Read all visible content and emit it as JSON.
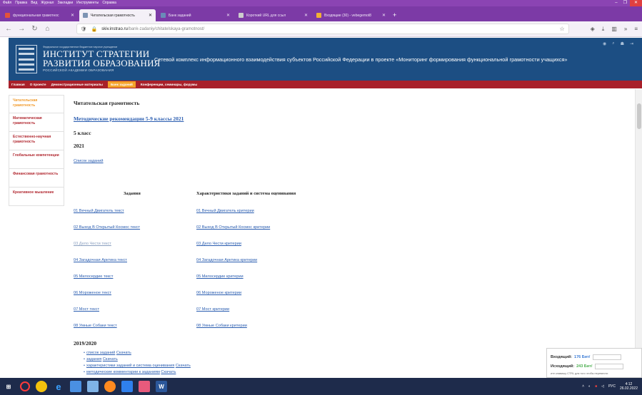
{
  "browser": {
    "menu": [
      "Файл",
      "Правка",
      "Вид",
      "Журнал",
      "Закладки",
      "Инструменты",
      "Справка"
    ],
    "window_controls": [
      "–",
      "❐",
      "✕"
    ],
    "tabs": [
      {
        "label": "функциональная грамотнос",
        "active": false,
        "color": "#e2533a"
      },
      {
        "label": "Читательская грамотность",
        "active": true,
        "color": "#7d93b3"
      },
      {
        "label": "Банк заданий",
        "active": false,
        "color": "#6a8bb8"
      },
      {
        "label": "Короткий URL для ссыл",
        "active": false,
        "color": "#cccccc"
      },
      {
        "label": "Входящие (30) - vebegemot8",
        "active": false,
        "color": "#f2b134"
      }
    ],
    "new_tab": "+",
    "url_host": "skiv.instrao.ru",
    "url_path": "/bank-zadaniy/chitatelskaya-gramotnost/"
  },
  "site": {
    "logo_small": "Федеральное государственное бюджетное научное учреждение",
    "logo_line1": "ИНСТИТУТ СТРАТЕГИИ",
    "logo_line2": "РАЗВИТИЯ ОБРАЗОВАНИЯ",
    "logo_sub": "РОССИЙСКОЙ АКАДЕМИИ ОБРАЗОВАНИЯ",
    "slogan": "Сетевой комплекс информационного взаимодействия субъектов Российской Федерации в проекте «Мониторинг формирования функциональной грамотности учащихся»",
    "nav": [
      {
        "label": "Главная",
        "active": false
      },
      {
        "label": "О проекте",
        "active": false
      },
      {
        "label": "Демонстрационные материалы",
        "active": false
      },
      {
        "label": "Банк заданий",
        "active": true
      },
      {
        "label": "Конференции, семинары, форумы",
        "active": false
      }
    ],
    "sidebar": [
      "Читательская грамотность",
      "Математическая грамотность",
      "Естественно-научная грамотность",
      "Глобальные компетенции",
      "Финансовая грамотность",
      "Креативное мышление"
    ]
  },
  "main": {
    "title": "Читательская грамотность",
    "metod_link": "Методические рекомендации 5-9 классы 2021",
    "grade": "5 класс",
    "year": "2021",
    "list_link": "Список заданий",
    "col1_head": "Задания",
    "col2_head": "Характеристики заданий и система оценивания",
    "tasks": [
      {
        "text": "01 Вечный Двигатель текст",
        "criteria": "01 Вечный Двигатель критерии",
        "dim": false
      },
      {
        "text": "02 Выход В Открытый Космос текст",
        "criteria": "02 Выход В Открытый Космос критерии",
        "dim": false
      },
      {
        "text": "03 Дело Чести текст",
        "criteria": "03 Дело Чести критерии",
        "dim": true
      },
      {
        "text": "04 Загадочная Арктика текст",
        "criteria": "04 Загадочная Арктика критерии",
        "dim": false
      },
      {
        "text": "05 Милосердие текст",
        "criteria": "05 Милосердие критерии",
        "dim": false
      },
      {
        "text": "06 Мороженое текст",
        "criteria": "06 Мороженое критерии",
        "dim": false
      },
      {
        "text": "07 Мост текст",
        "criteria": "07 Мост критерии",
        "dim": false
      },
      {
        "text": "08 Умные Собаки текст",
        "criteria": "08 Умные Собаки критерии",
        "dim": false
      }
    ],
    "year2": "2019/2020",
    "bullets": [
      {
        "a": "список заданий",
        "b": "Скачать"
      },
      {
        "a": "задания",
        "b": "Скачать"
      },
      {
        "a": "характеристики заданий и система оценивания",
        "b": "Скачать"
      },
      {
        "a": "методические комментарии к заданиям",
        "b": "Скачать"
      }
    ]
  },
  "traffic": {
    "in_label": "Входящий:",
    "in_value": "176 Бит/",
    "out_label": "Исходящий:",
    "out_value": "243 Бит/",
    "hint": "ите клавишу CTRL для того чтобы перемести"
  },
  "taskbar": {
    "lang": "РУС",
    "time": "4:12",
    "date": "26.02.2022"
  }
}
